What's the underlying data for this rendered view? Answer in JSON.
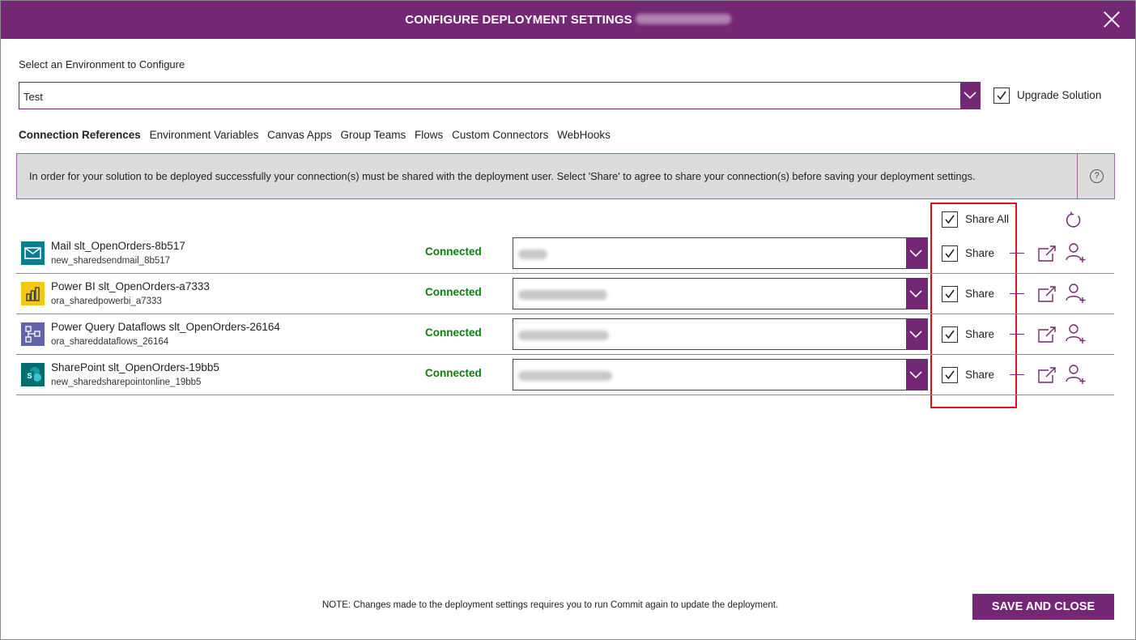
{
  "dialog": {
    "title": "CONFIGURE DEPLOYMENT SETTINGS",
    "close_icon": "close-icon"
  },
  "environment": {
    "label": "Select an Environment to Configure",
    "selected": "Test",
    "upgrade_label": "Upgrade Solution",
    "upgrade_checked": true
  },
  "tabs": [
    {
      "label": "Connection References",
      "active": true
    },
    {
      "label": "Environment Variables",
      "active": false
    },
    {
      "label": "Canvas Apps",
      "active": false
    },
    {
      "label": "Group Teams",
      "active": false
    },
    {
      "label": "Flows",
      "active": false
    },
    {
      "label": "Custom Connectors",
      "active": false
    },
    {
      "label": "WebHooks",
      "active": false
    }
  ],
  "banner": {
    "message": "In order for your solution to be deployed successfully your connection(s) must be shared with the deployment user. Select 'Share' to agree to share your connection(s) before saving your deployment settings.",
    "help_icon": "?"
  },
  "share_all": {
    "label": "Share All",
    "checked": true
  },
  "connections": [
    {
      "name": "Mail slt_OpenOrders-8b517",
      "logical_name": "new_sharedsendmail_8b517",
      "status": "Connected",
      "share_label": "Share",
      "icon": "mail-icon",
      "icon_color": "#0a7f8c"
    },
    {
      "name": "Power BI slt_OpenOrders-a7333",
      "logical_name": "ora_sharedpowerbi_a7333",
      "status": "Connected",
      "share_label": "Share",
      "icon": "powerbi-icon",
      "icon_color": "#f2c811"
    },
    {
      "name": "Power Query Dataflows slt_OpenOrders-26164",
      "logical_name": "ora_shareddataflows_26164",
      "status": "Connected",
      "share_label": "Share",
      "icon": "dataflows-icon",
      "icon_color": "#6264a7"
    },
    {
      "name": "SharePoint slt_OpenOrders-19bb5",
      "logical_name": "new_sharedsharepointonline_19bb5",
      "status": "Connected",
      "share_label": "Share",
      "icon": "sharepoint-icon",
      "icon_color": "#036c70"
    }
  ],
  "footer": {
    "note": "NOTE: Changes made to the deployment settings requires you to run Commit again to update the deployment.",
    "save_label": "SAVE AND CLOSE"
  },
  "colors": {
    "accent": "#742774",
    "status_ok": "#107c10",
    "highlight": "#e0101a"
  }
}
